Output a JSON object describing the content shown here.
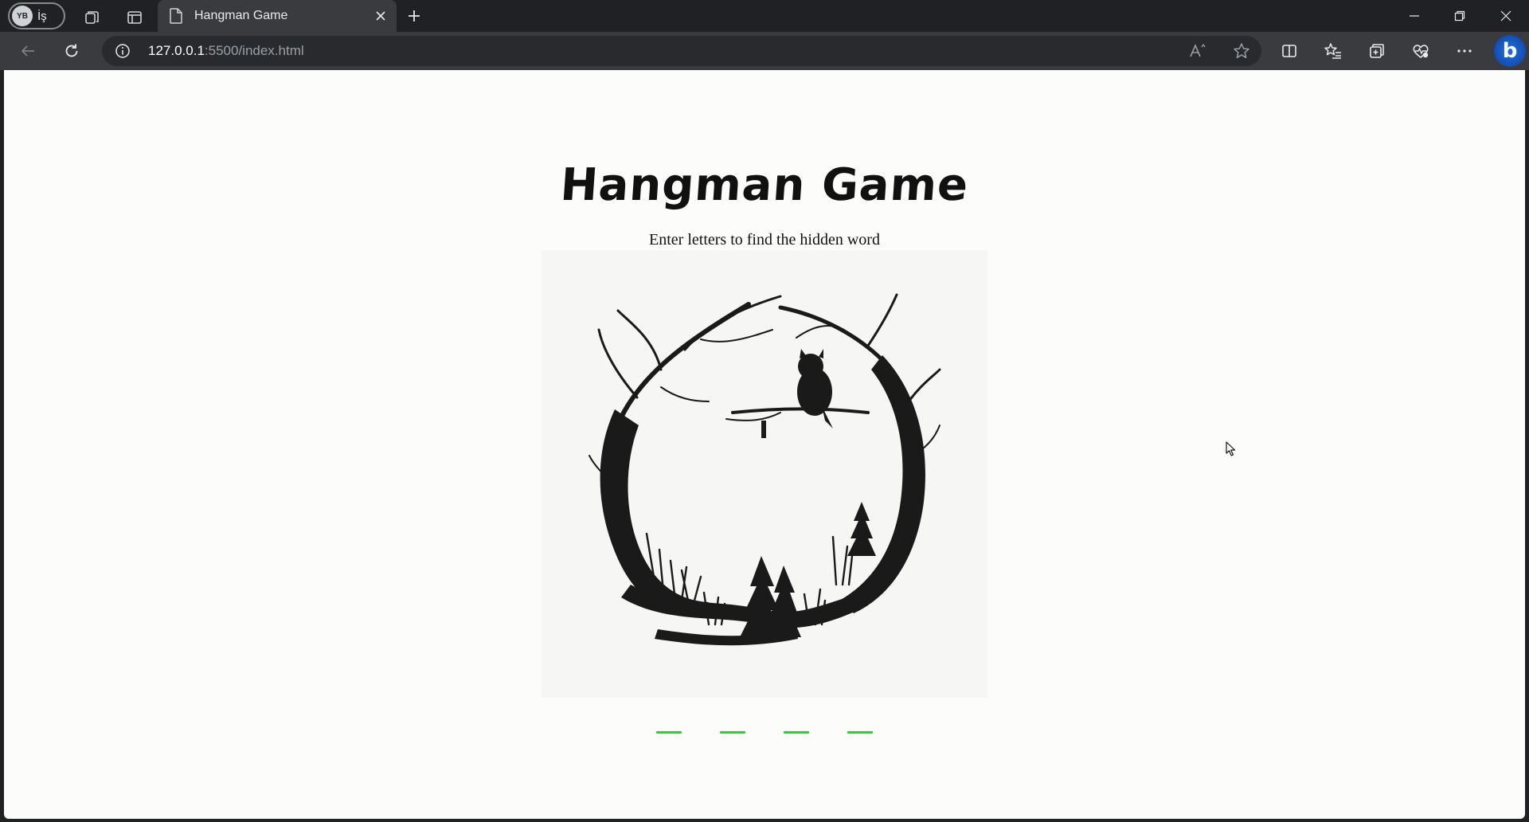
{
  "profile": {
    "initials": "YB",
    "label": "İş"
  },
  "tab": {
    "title": "Hangman Game"
  },
  "address": {
    "host": "127.0.0.1",
    "path": ":5500/index.html"
  },
  "page": {
    "title": "Hangman Game",
    "subtitle": "Enter letters to find the hidden word",
    "word_slots": 4,
    "slot_color": "#41c241"
  },
  "icons": {
    "titlebar": [
      "workspaces-icon",
      "vertical-tabs-icon",
      "page-icon",
      "close-icon",
      "new-tab-icon",
      "minimize-icon",
      "restore-icon",
      "window-close-icon"
    ],
    "toolbar": [
      "back-icon",
      "refresh-icon",
      "info-icon",
      "read-aloud-icon",
      "favorite-star-icon",
      "split-screen-icon",
      "favorites-icon",
      "collections-icon",
      "browser-essentials-icon",
      "more-icon",
      "copilot-icon"
    ]
  }
}
